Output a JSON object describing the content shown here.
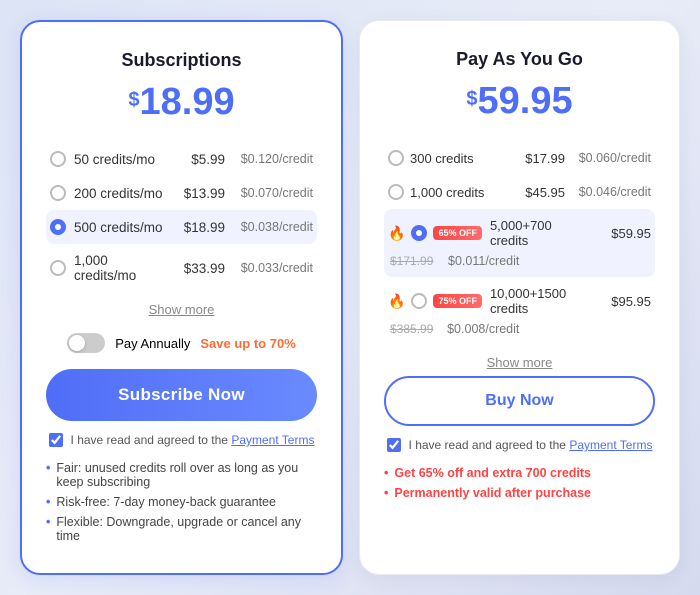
{
  "left_card": {
    "title": "Subscriptions",
    "price": "18.99",
    "price_symbol": "$",
    "plans": [
      {
        "name": "50 credits/mo",
        "price": "$5.99",
        "per_credit": "$0.120/credit",
        "selected": false
      },
      {
        "name": "200 credits/mo",
        "price": "$13.99",
        "per_credit": "$0.070/credit",
        "selected": false
      },
      {
        "name": "500 credits/mo",
        "price": "$18.99",
        "per_credit": "$0.038/credit",
        "selected": true
      },
      {
        "name": "1,000 credits/mo",
        "price": "$33.99",
        "per_credit": "$0.033/credit",
        "selected": false
      }
    ],
    "show_more": "Show more",
    "toggle_label": "Pay Annually",
    "save_label": "Save up to 70%",
    "subscribe_btn": "Subscribe Now",
    "agree_text": "I have read and agreed to the",
    "agree_link": "Payment Terms",
    "bullets": [
      "Fair: unused credits roll over as long as you keep subscribing",
      "Risk-free: 7-day money-back guarantee",
      "Flexible: Downgrade, upgrade or cancel any time"
    ]
  },
  "right_card": {
    "title": "Pay As You Go",
    "price": "59.95",
    "price_symbol": "$",
    "plans": [
      {
        "name": "300 credits",
        "price": "$17.99",
        "per_credit": "$0.060/credit",
        "selected": false,
        "badge": null,
        "fire": false,
        "original_price": null
      },
      {
        "name": "1,000 credits",
        "price": "$45.95",
        "per_credit": "$0.046/credit",
        "selected": false,
        "badge": null,
        "fire": false,
        "original_price": null
      },
      {
        "name": "5,000+700 credits",
        "price": "$59.95",
        "per_credit": "$0.011/credit",
        "selected": true,
        "badge": "65% OFF",
        "fire": true,
        "original_price": "$171.99"
      },
      {
        "name": "10,000+1500 credits",
        "price": "$95.95",
        "per_credit": "$0.008/credit",
        "selected": false,
        "badge": "75% OFF",
        "fire": true,
        "original_price": "$385.99"
      }
    ],
    "show_more": "Show more",
    "buy_btn": "Buy Now",
    "agree_text": "I have read and agreed to the",
    "agree_link": "Payment Terms",
    "bullets": [
      "Get 65% off and extra 700 credits",
      "Permanently valid after purchase"
    ]
  }
}
